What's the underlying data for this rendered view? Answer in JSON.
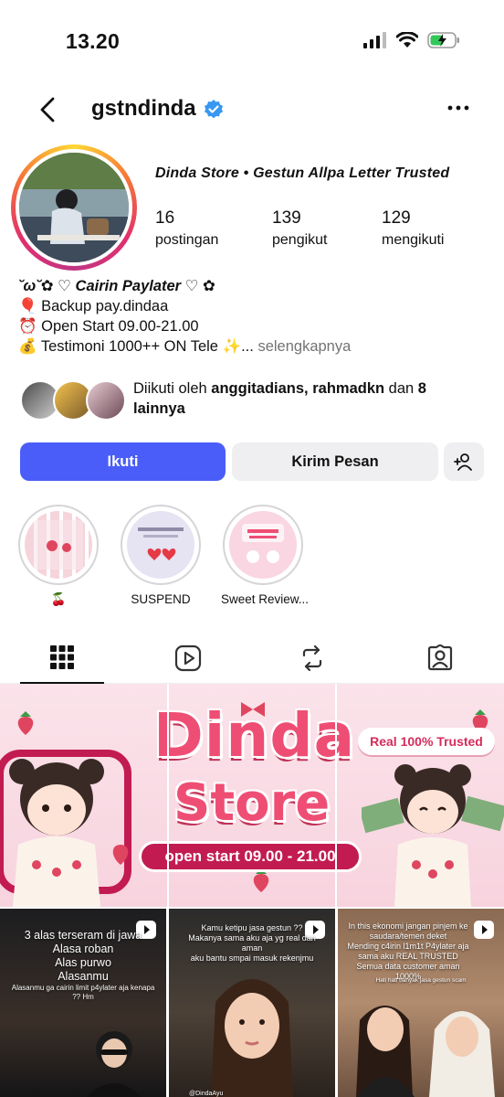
{
  "status_bar": {
    "time": "13.20"
  },
  "header": {
    "username": "gstndinda"
  },
  "profile": {
    "display_name": "Dinda Store • Gestun Allpa Letter Trusted",
    "stats": [
      {
        "value": "16",
        "label": "postingan"
      },
      {
        "value": "139",
        "label": "pengikut"
      },
      {
        "value": "129",
        "label": "mengikuti"
      }
    ],
    "bio": [
      "˘ω˘✿ ♡ Cairin Paylater ♡ ✿",
      "🎈 Backup pay.dindaa",
      "⏰ Open Start 09.00-21.00",
      "💰 Testimoni 1000++ ON Tele ✨..."
    ],
    "bio_more": "selengkapnya",
    "followed_by": {
      "prefix": "Diikuti oleh ",
      "names": "anggitadians, rahmadkn",
      "middle": " dan ",
      "others": "8 lainnya"
    }
  },
  "buttons": {
    "follow": "Ikuti",
    "message": "Kirim Pesan"
  },
  "highlights": [
    {
      "label": "🍒"
    },
    {
      "label": "SUSPEND"
    },
    {
      "label": "Sweet Review..."
    }
  ],
  "tabs": [
    "grid-icon",
    "reels-icon",
    "reposts-icon",
    "tagged-icon"
  ],
  "banner": {
    "title_top": "Dinda",
    "title_bottom": "Store",
    "hours": "open start 09.00 - 21.00",
    "trusted": "Real 100% Trusted"
  },
  "reels": [
    {
      "lines": [
        "3 alas terseram di jawa",
        "Alasa roban",
        "Alas purwo",
        "Alasanmu"
      ],
      "sub": "Alasanmu ga cairin limit p4ylater aja kenapa ?? Hm"
    },
    {
      "lines": [
        "Kamu ketipu jasa gestun ??",
        "Makanya sama aku aja yg real dan aman",
        "aku bantu smpai masuk rekenjmu"
      ],
      "sub": "@DindaAyu"
    },
    {
      "lines": [
        "In this ekonomi jangan pinjem ke saudara/temen deket",
        "Mending c4irin l1m1t P4ylater aja sama aku REAL TRUSTED",
        "Semua data customer aman 1000%"
      ],
      "sub": "Hati hati banyak jasa gestun scam"
    }
  ],
  "colors": {
    "follow": "#4a5df9",
    "verified": "#3897f0"
  }
}
